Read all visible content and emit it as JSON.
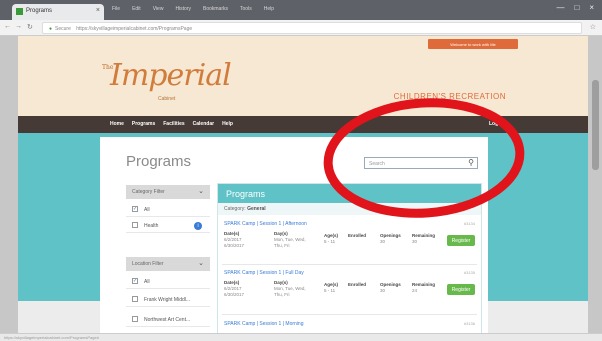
{
  "browser": {
    "tab_title": "Programs",
    "tab_close": "×",
    "menus": [
      "File",
      "Edit",
      "View",
      "History",
      "Bookmarks",
      "Tools",
      "Help"
    ],
    "window_controls": [
      "—",
      "□",
      "×"
    ],
    "url": "https://skyvillageimperialcabinet.com/ProgramsPage",
    "secure_label": "Secure"
  },
  "header": {
    "welcome_button": "Welcome to work with Me",
    "logo_the": "The",
    "logo_name": "Imperial",
    "logo_sub": "Cabinet",
    "tagline": "CHILDREN'S RECREATION"
  },
  "nav": {
    "items": [
      "Home",
      "Programs",
      "Facilities",
      "Calendar",
      "Help"
    ],
    "login": "Log In"
  },
  "main": {
    "title": "Programs",
    "search_placeholder": "Search"
  },
  "filters": {
    "category": {
      "label": "Category Filter",
      "items": [
        {
          "label": "All",
          "checked": true
        },
        {
          "label": "Health",
          "checked": false,
          "badge": "i"
        }
      ]
    },
    "location": {
      "label": "Location Filter",
      "items": [
        {
          "label": "All",
          "checked": true
        },
        {
          "label": "Frank Wright Middl...",
          "checked": false
        },
        {
          "label": "Northwest Art Cent...",
          "checked": false
        }
      ]
    }
  },
  "panel": {
    "title": "Programs",
    "category_prefix": "Category:",
    "category": "General",
    "headers": {
      "dates": "Date(s)",
      "days": "Day(s)",
      "ages": "Age(s)",
      "enrolled": "Enrolled",
      "openings": "Openings",
      "remaining": "Remaining"
    },
    "register_label": "Register",
    "sessions": [
      {
        "title": "SPARK Camp | Session 1 | Afternoon",
        "id": "#3134",
        "dates": [
          "6/2/2017",
          "6/30/2017"
        ],
        "days": [
          "Mon, Tue, Wed,",
          "Thu, Fri"
        ],
        "ages": "5 - 11",
        "enrolled": "",
        "openings": "30",
        "remaining": "30"
      },
      {
        "title": "SPARK Camp | Session 1 | Full Day",
        "id": "#3135",
        "dates": [
          "6/2/2017",
          "6/30/2017"
        ],
        "days": [
          "Mon, Tue, Wed,",
          "Thu, Fri"
        ],
        "ages": "5 - 11",
        "enrolled": "",
        "openings": "30",
        "remaining": "24"
      },
      {
        "title": "SPARK Camp | Session 1 | Morning",
        "id": "#3136"
      }
    ]
  },
  "status_bar": "https://skyvillageimperialcabinet.com/ProgramsPage#",
  "colors": {
    "teal": "#5ec2c7",
    "navbar": "#463a36",
    "header_bg": "#f6e8d2",
    "accent_orange": "#e06b3a",
    "register_green": "#67b94c",
    "annotation_red": "#e0141a"
  }
}
